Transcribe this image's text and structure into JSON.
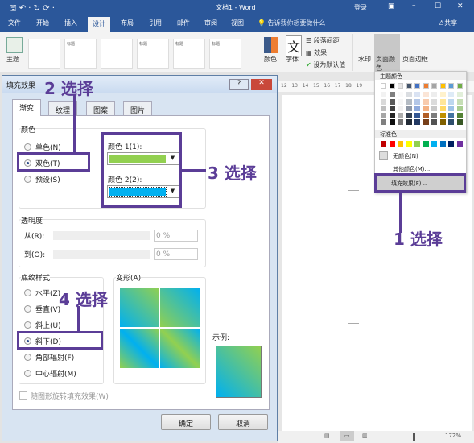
{
  "window": {
    "title": "文档1 - Word",
    "signin": "登录",
    "share": "共享"
  },
  "tabs": [
    "文件",
    "开始",
    "插入",
    "设计",
    "布局",
    "引用",
    "邮件",
    "审阅",
    "视图"
  ],
  "active_tab": "设计",
  "tell_me": "告诉我你想要做什么",
  "ribbon": {
    "theme": "主题",
    "colors": "颜色",
    "fonts": "字体",
    "para_spacing": "段落间距",
    "effects": "效果",
    "set_default": "设为默认值",
    "watermark": "水印",
    "page_color": "页面颜色",
    "page_borders": "页面边框",
    "thumbs": [
      "标题",
      "标题",
      "标题",
      "标题",
      "标题",
      "标题"
    ]
  },
  "ruler": "12 · 13 · 14 · 15 · 16 · 17 · 18 · 19",
  "status": {
    "zoom": "172%"
  },
  "menu": {
    "theme_colors_label": "主题颜色",
    "standard_label": "标准色",
    "no_color": "无颜色(N)",
    "more_colors": "其他颜色(M)...",
    "fill_effects": "填充效果(F)...",
    "theme_colors": [
      "#ffffff",
      "#000000",
      "#e7e6e6",
      "#44546a",
      "#4472c4",
      "#ed7d31",
      "#a5a5a5",
      "#ffc000",
      "#5b9bd5",
      "#70ad47"
    ],
    "standard_colors": [
      "#c00000",
      "#ff0000",
      "#ffc000",
      "#ffff00",
      "#92d050",
      "#00b050",
      "#00b0f0",
      "#0070c0",
      "#002060",
      "#7030a0"
    ]
  },
  "dialog": {
    "title": "填充效果",
    "help": "?",
    "close": "✕",
    "tabs": [
      "渐变",
      "纹理",
      "图案",
      "图片"
    ],
    "color_group": "颜色",
    "one_color": "单色(N)",
    "two_colors": "双色(T)",
    "preset": "预设(S)",
    "color1_label": "颜色 1(1):",
    "color2_label": "颜色 2(2):",
    "color1": "#92d050",
    "color2": "#00b0f0",
    "transparency": "透明度",
    "from": "从(R):",
    "to": "到(O):",
    "from_value": "0 %",
    "to_value": "0 %",
    "shading_styles": "底纹样式",
    "styles": [
      "水平(Z)",
      "垂直(V)",
      "斜上(U)",
      "斜下(D)",
      "角部辐射(F)",
      "中心辐射(M)"
    ],
    "selected_style": "斜下(D)",
    "variants": "变形(A)",
    "sample": "示例:",
    "rotate": "随图形旋转填充效果(W)",
    "ok": "确定",
    "cancel": "取消"
  },
  "annotations": [
    "1 选择",
    "2 选择",
    "3 选择",
    "4 选择"
  ],
  "annotation_color": "#5b3d97"
}
